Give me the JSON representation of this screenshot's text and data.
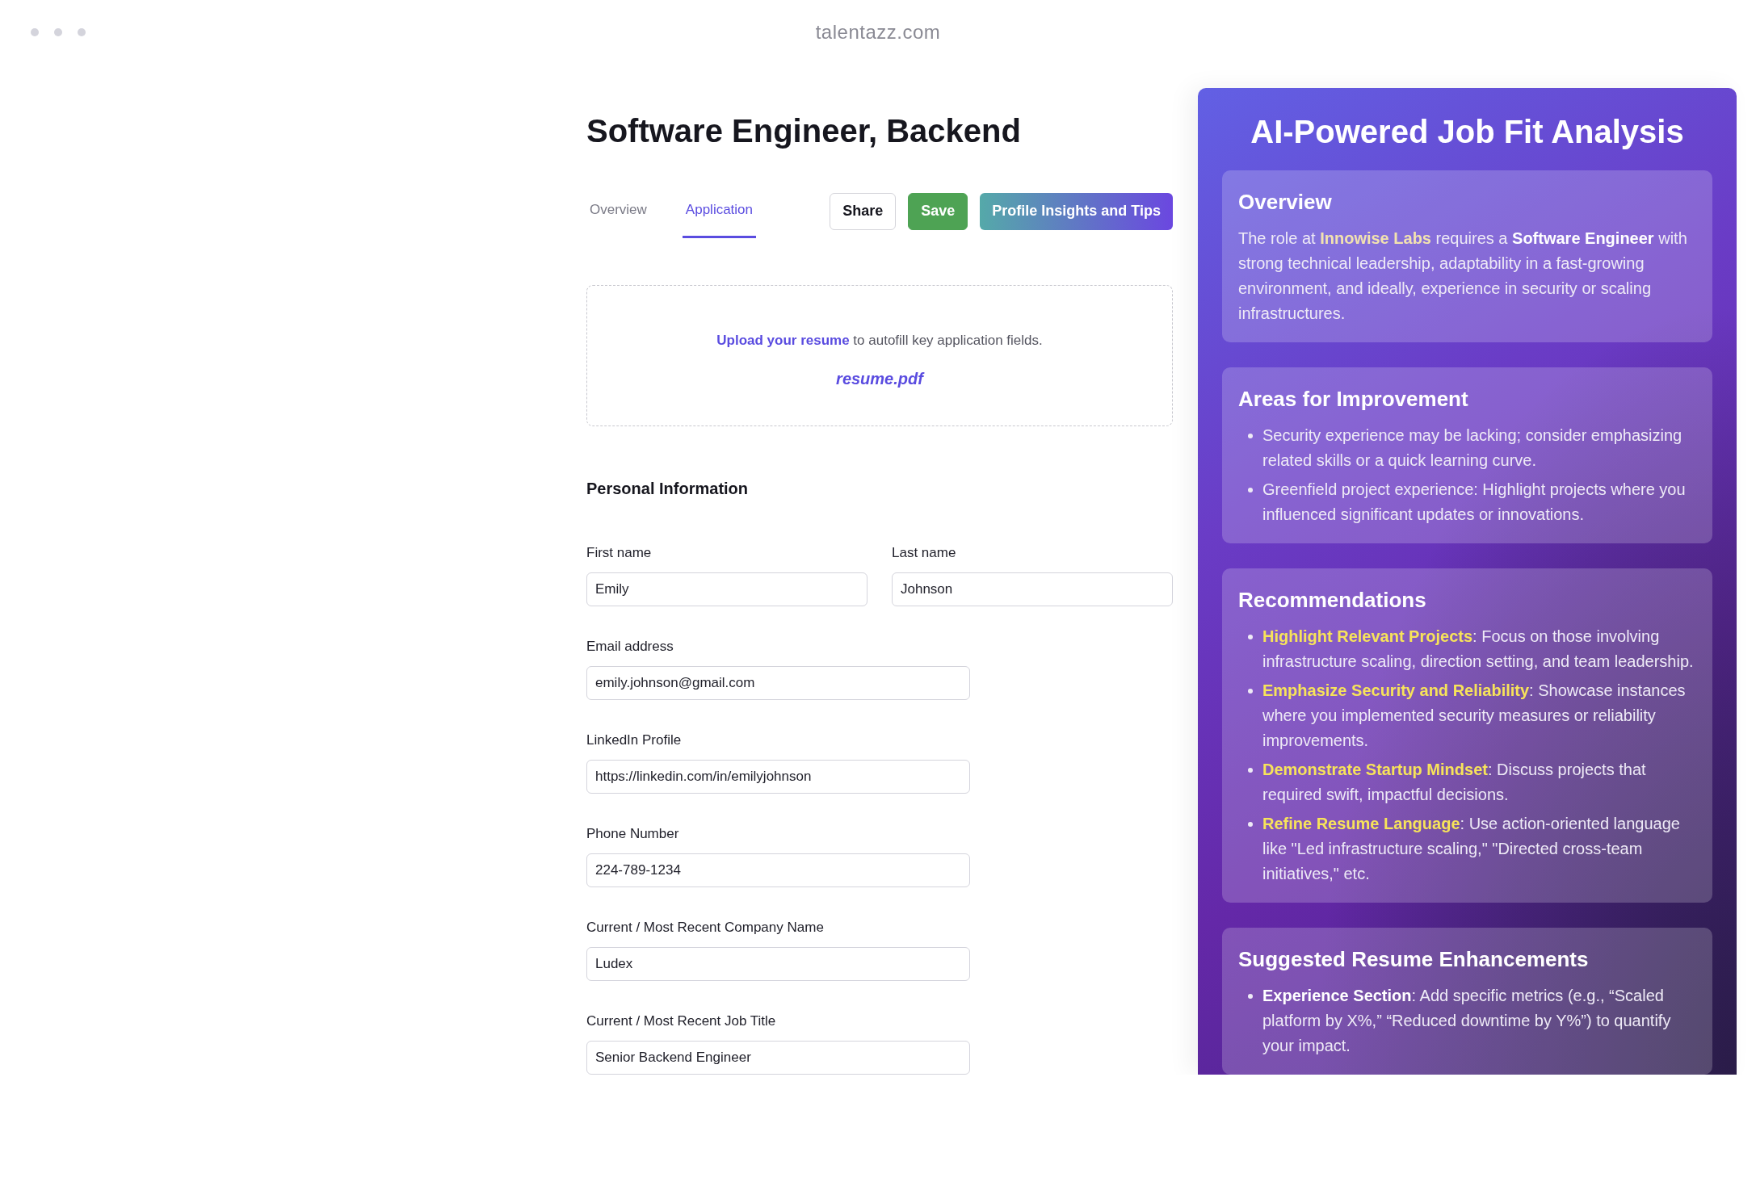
{
  "browser": {
    "address": "talentazz.com"
  },
  "job": {
    "title": "Software Engineer, Backend"
  },
  "tabs": [
    {
      "label": "Overview",
      "selected": false
    },
    {
      "label": "Application",
      "selected": true
    }
  ],
  "actions": [
    {
      "label": "Share",
      "kind": "outline"
    },
    {
      "label": "Save",
      "kind": "success"
    },
    {
      "label": "Profile Insights and Tips",
      "kind": "gradient"
    }
  ],
  "upload": {
    "link": "Upload your resume",
    "text": " to autofill key application fields.",
    "file": "resume.pdf"
  },
  "form": {
    "section": "Personal Information",
    "rows": [
      {
        "fields": [
          {
            "label": "First name",
            "value": "Emily"
          },
          {
            "label": "Last name",
            "value": "Johnson"
          }
        ]
      },
      {
        "fields": [
          {
            "label": "Email address",
            "value": "emily.johnson@gmail.com"
          }
        ]
      },
      {
        "fields": [
          {
            "label": "LinkedIn Profile",
            "value": "https://linkedin.com/in/emilyjohnson"
          }
        ]
      },
      {
        "fields": [
          {
            "label": "Phone Number",
            "value": "224-789-1234"
          }
        ]
      },
      {
        "fields": [
          {
            "label": "Current / Most Recent Company Name",
            "value": "Ludex"
          }
        ]
      },
      {
        "fields": [
          {
            "label": "Current / Most Recent Job Title",
            "value": "Senior Backend Engineer"
          }
        ]
      }
    ]
  },
  "analysis": {
    "title": "AI-Powered Job Fit Analysis",
    "cards": [
      {
        "heading": "Overview",
        "kind": "paragraph",
        "segments": [
          {
            "text": "The role at ",
            "kind": "plain"
          },
          {
            "text": "Innowise Labs",
            "kind": "company"
          },
          {
            "text": " requires a ",
            "kind": "plain"
          },
          {
            "text": "Software Engineer",
            "kind": "bold"
          },
          {
            "text": " with strong technical leadership, adaptability in a fast-growing environment, and ideally, experience in security or scaling infrastructures.",
            "kind": "plain"
          }
        ]
      },
      {
        "heading": "Areas for Improvement",
        "kind": "list",
        "items": [
          {
            "text": "Security experience may be lacking; consider emphasizing related skills or a quick learning curve."
          },
          {
            "text": "Greenfield project experience: Highlight projects where you influenced significant updates or innovations."
          }
        ]
      },
      {
        "heading": "Recommendations",
        "kind": "list",
        "items": [
          {
            "kind": "highlight",
            "term": "Highlight Relevant Projects",
            "text": ": Focus on those involving infrastructure scaling, direction setting, and team leadership."
          },
          {
            "kind": "highlight",
            "term": "Emphasize Security and Reliability",
            "text": ": Showcase instances where you implemented security measures or reliability improvements."
          },
          {
            "kind": "highlight",
            "term": "Demonstrate Startup Mindset",
            "text": ": Discuss projects that required swift, impactful decisions."
          },
          {
            "kind": "highlight",
            "term": "Refine Resume Language",
            "text": ": Use action-oriented language like \"Led infrastructure scaling,\" \"Directed cross-team initiatives,\" etc."
          }
        ]
      },
      {
        "heading": "Suggested Resume Enhancements",
        "kind": "list",
        "items": [
          {
            "kind": "bold",
            "term": "Experience Section",
            "text": ": Add specific metrics (e.g., “Scaled platform by X%,” “Reduced downtime by Y%”) to quantify your impact."
          }
        ]
      }
    ]
  }
}
